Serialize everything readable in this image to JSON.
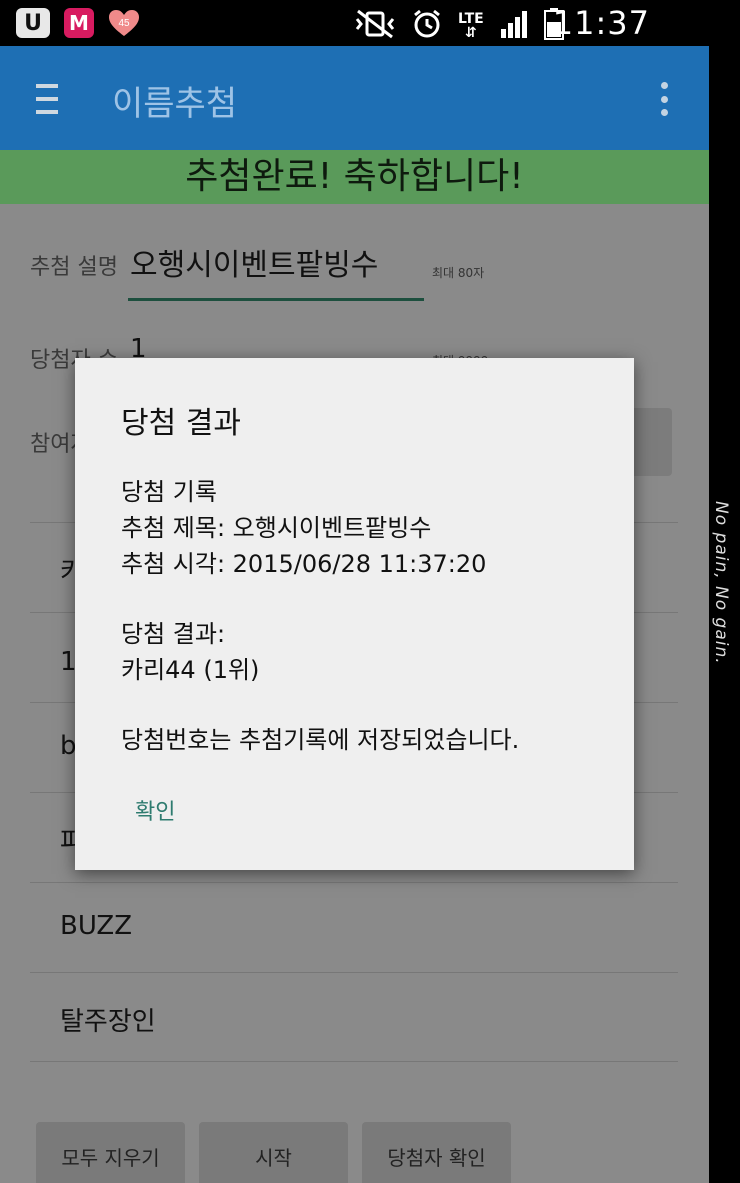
{
  "statusbar": {
    "u_badge": "U",
    "m_badge": "M",
    "heart_badge": "45",
    "network": "LTE",
    "time": "11:37"
  },
  "toolbar": {
    "title": "이름추첨"
  },
  "banner": {
    "text": "추첨완료! 축하합니다!"
  },
  "form": {
    "desc_label": "추첨 설명",
    "desc_value": "오행시이벤트팥빙수",
    "desc_hint": "최대 80자",
    "winners_label": "당첨자 수",
    "winners_value": "1",
    "winners_hint": "최대 9999",
    "participants_label": "참여자"
  },
  "list": {
    "items": [
      "카리44",
      "1번",
      "b",
      "파",
      "BUZZ",
      "탈주장인"
    ]
  },
  "buttons": {
    "clear": "모두 지우기",
    "start": "시작",
    "check": "당첨자 확인"
  },
  "dialog": {
    "title": "당첨 결과",
    "line1": "당첨 기록",
    "line2": "추첨 제목: 오행시이벤트팥빙수",
    "line3": "추첨 시각: 2015/06/28 11:37:20",
    "line4": "당첨 결과:",
    "line5": "카리44 (1위)",
    "line6": "당첨번호는 추첨기록에 저장되었습니다.",
    "ok": "확인"
  },
  "side_text": "No pain, No gain."
}
